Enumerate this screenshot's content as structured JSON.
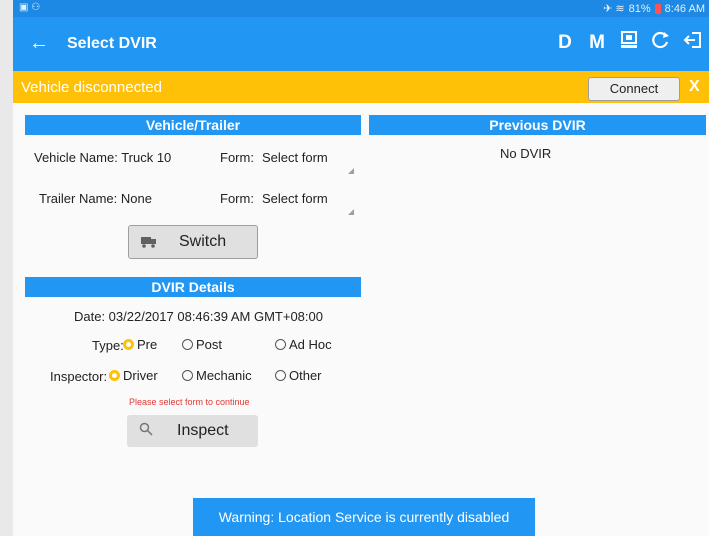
{
  "status_bar": {
    "battery": "81%",
    "time": "8:46 AM"
  },
  "app_bar": {
    "title": "Select DVIR",
    "actions": [
      "D",
      "M"
    ]
  },
  "banner": {
    "message": "Vehicle disconnected",
    "connect_label": "Connect",
    "close_label": "X"
  },
  "vehicle_trailer": {
    "header": "Vehicle/Trailer",
    "vehicle_label": "Vehicle Name: Truck 10",
    "trailer_label": "Trailer Name: None",
    "form_label": "Form:",
    "form_value": "Select form",
    "switch_label": "Switch"
  },
  "previous_dvir": {
    "header": "Previous DVIR",
    "empty_text": "No DVIR"
  },
  "dvir_details": {
    "header": "DVIR Details",
    "date": "Date: 03/22/2017 08:46:39 AM GMT+08:00",
    "type_label": "Type:",
    "type_options": [
      "Pre",
      "Post",
      "Ad Hoc"
    ],
    "inspector_label": "Inspector:",
    "inspector_options": [
      "Driver",
      "Mechanic",
      "Other"
    ],
    "error": "Please select form to continue",
    "inspect_label": "Inspect"
  },
  "toast": {
    "message": "Warning: Location Service is currently disabled"
  },
  "colors": {
    "primary": "#2196f3",
    "warning": "#ffc107",
    "error": "#e53935"
  }
}
